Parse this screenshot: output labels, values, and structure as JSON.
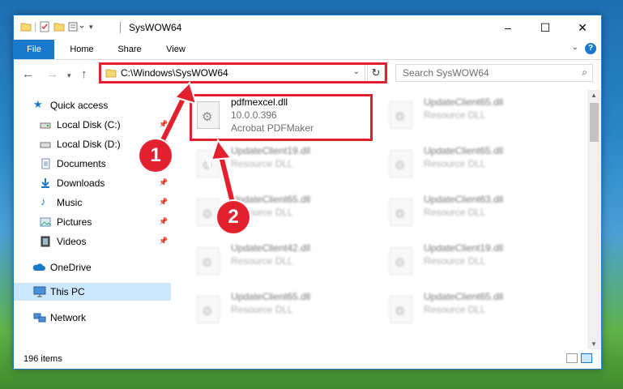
{
  "window": {
    "title": "SysWOW64",
    "controls": {
      "minimize": "–",
      "maximize": "☐",
      "close": "✕"
    }
  },
  "ribbon": {
    "tabs": [
      "File",
      "Home",
      "Share",
      "View"
    ],
    "help": "?"
  },
  "navigation": {
    "address": "C:\\Windows\\SysWOW64",
    "search_placeholder": "Search SysWOW64"
  },
  "sidebar": {
    "items": [
      {
        "label": "Quick access",
        "icon": "star-icon",
        "pinned": false
      },
      {
        "label": "Local Disk (C:)",
        "icon": "drive-icon",
        "pinned": true
      },
      {
        "label": "Local Disk (D:)",
        "icon": "drive-icon",
        "pinned": true
      },
      {
        "label": "Documents",
        "icon": "documents-icon",
        "pinned": true
      },
      {
        "label": "Downloads",
        "icon": "download-icon",
        "pinned": true
      },
      {
        "label": "Music",
        "icon": "music-icon",
        "pinned": true
      },
      {
        "label": "Pictures",
        "icon": "pictures-icon",
        "pinned": true
      },
      {
        "label": "Videos",
        "icon": "videos-icon",
        "pinned": true
      },
      {
        "label": "OneDrive",
        "icon": "cloud-icon",
        "pinned": false
      },
      {
        "label": "This PC",
        "icon": "pc-icon",
        "pinned": false,
        "selected": true
      },
      {
        "label": "Network",
        "icon": "network-icon",
        "pinned": false
      }
    ]
  },
  "files": {
    "highlighted": {
      "name": "pdfmexcel.dll",
      "version": "10.0.0.396",
      "description": "Acrobat PDFMaker"
    },
    "items": [
      {
        "name": "UpdateClient65.dll",
        "description": "Resource DLL"
      },
      {
        "name": "UpdateClient19.dll",
        "description": "Resource DLL"
      },
      {
        "name": "UpdateClient65.dll",
        "description": "Resource DLL"
      },
      {
        "name": "UpdateClient65.dll",
        "description": "Resource DLL"
      },
      {
        "name": "UpdateClient63.dll",
        "description": "Resource DLL"
      },
      {
        "name": "UpdateClient42.dll",
        "description": "Resource DLL"
      },
      {
        "name": "UpdateClient19.dll",
        "description": "Resource DLL"
      },
      {
        "name": "UpdateClient65.dll",
        "description": "Resource DLL"
      },
      {
        "name": "UpdateClient65.dll",
        "description": "Resource DLL"
      }
    ]
  },
  "status": {
    "item_count": "196 items"
  },
  "callouts": {
    "step1": "1",
    "step2": "2"
  },
  "colors": {
    "accent": "#1979ca",
    "highlight": "#e2202e",
    "selection": "#cce8ff"
  }
}
